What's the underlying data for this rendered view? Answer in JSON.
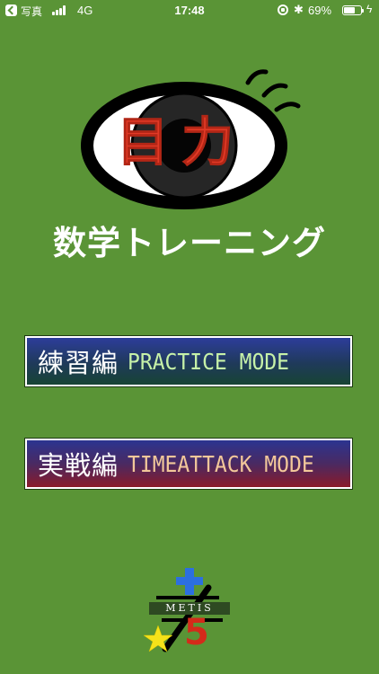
{
  "status_bar": {
    "back_app": "写真",
    "network": "4G",
    "time": "17:48",
    "battery_percent": "69%",
    "battery_level": 0.69
  },
  "logo": {
    "title": "目力"
  },
  "subtitle": "数学トレーニング",
  "buttons": {
    "practice": {
      "jp_label": "練習編",
      "en_label": "PRACTICE MODE"
    },
    "timeattack": {
      "jp_label": "実戦編",
      "en_label": "TIMEATTACK MODE"
    }
  },
  "company": {
    "name": "METIS",
    "number": "5"
  },
  "colors": {
    "background": "#5a9436",
    "logo_text": "#e23a26",
    "practice_text": "#c6f1a8",
    "timeattack_text": "#f2c79a"
  }
}
